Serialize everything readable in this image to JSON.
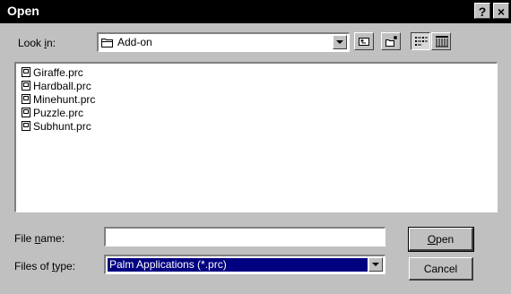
{
  "window": {
    "title": "Open",
    "help_label": "?",
    "close_label": "×"
  },
  "look_in": {
    "label_pre": "Look ",
    "label_key": "i",
    "label_post": "n:",
    "value": "Add-on"
  },
  "files": [
    {
      "name": "Giraffe.prc"
    },
    {
      "name": "Hardball.prc"
    },
    {
      "name": "Minehunt.prc"
    },
    {
      "name": "Puzzle.prc"
    },
    {
      "name": "Subhunt.prc"
    }
  ],
  "file_name": {
    "label_pre": "File ",
    "label_key": "n",
    "label_post": "ame:",
    "value": ""
  },
  "file_type": {
    "label_pre": "Files of ",
    "label_key": "t",
    "label_post": "ype:",
    "value": "Palm Applications (*.prc)"
  },
  "buttons": {
    "open_key": "O",
    "open_rest": "pen",
    "cancel": "Cancel"
  }
}
